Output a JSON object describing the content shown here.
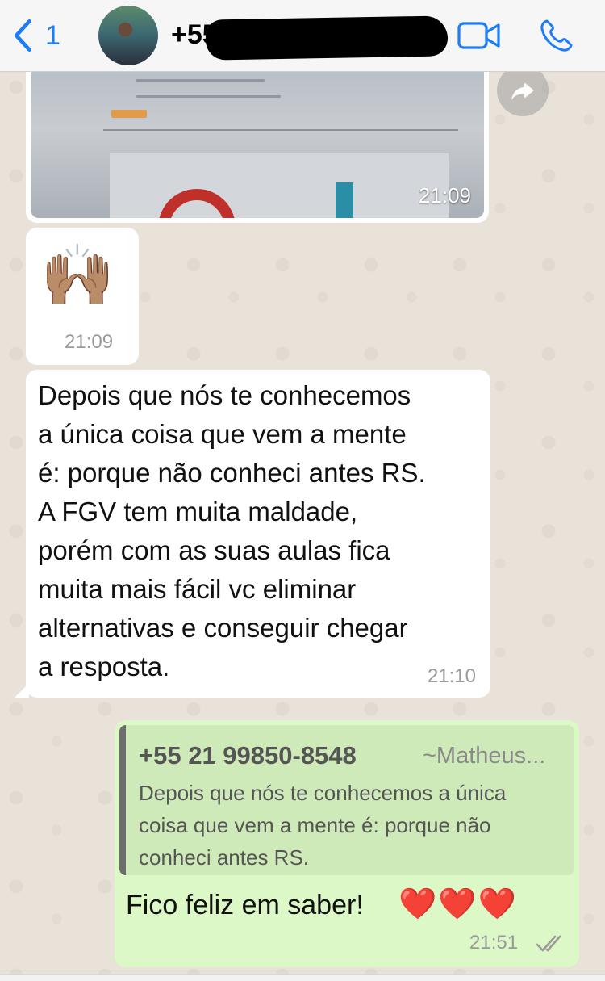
{
  "header": {
    "back_count": "1",
    "contact_name": "+55",
    "icons": [
      "back-chevron-icon",
      "video-call-icon",
      "phone-icon"
    ]
  },
  "messages": {
    "image": {
      "time": "21:09"
    },
    "emoji": {
      "text": "🙌🏽",
      "time": "21:09"
    },
    "text": {
      "body": "Depois que nós te conhecemos\na única coisa que vem a mente\né: porque não conheci antes RS.\nA FGV tem muita maldade,\nporém com as suas aulas fica\nmuita mais fácil vc eliminar\nalternativas e conseguir chegar\na resposta.",
      "time": "21:10"
    },
    "reply": {
      "quoted_phone": "+55 21 99850-8548",
      "quoted_author": "~Matheus...",
      "quoted_text": "Depois que nós te conhecemos a única coisa que vem a mente é: porque não conheci antes RS.",
      "text": "Fico feliz em saber!",
      "hearts": "❤️❤️❤️",
      "time": "21:51",
      "status": "read"
    }
  },
  "colors": {
    "accent": "#1E7CF6",
    "outgoing_bubble": "#DCF8C6",
    "incoming_bubble": "#FFFFFF",
    "chat_background": "#E9E2D8"
  }
}
